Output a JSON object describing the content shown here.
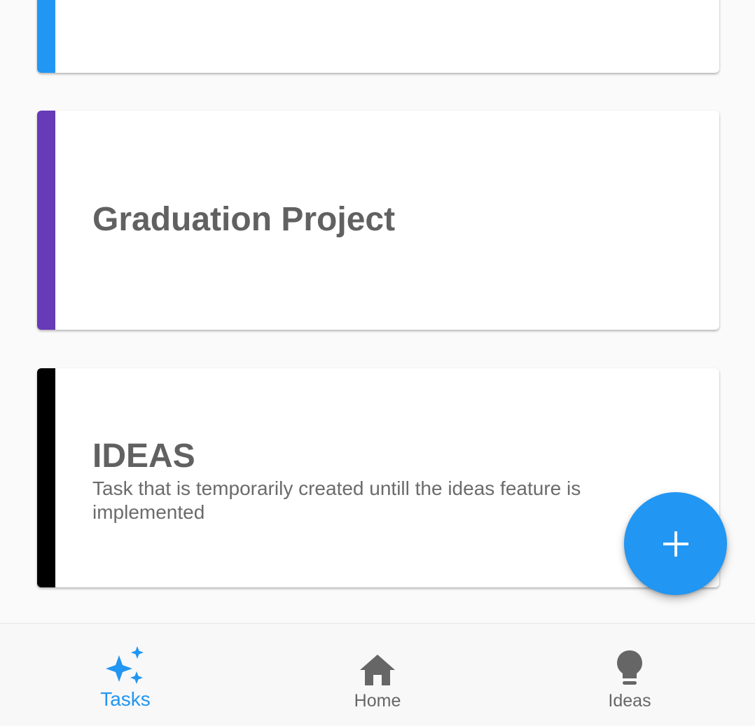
{
  "colors": {
    "accent": "#2196f3",
    "inactive": "#666666",
    "card_1_stripe": "#2196f3",
    "card_2_stripe": "#673ab7",
    "card_3_stripe": "#000000"
  },
  "cards": [
    {
      "title": "",
      "description": "",
      "stripe_color": "#2196f3"
    },
    {
      "title": "Graduation Project",
      "description": "",
      "stripe_color": "#673ab7"
    },
    {
      "title": "IDEAS",
      "description": "Task that is temporarily created untill the ideas feature is implemented",
      "stripe_color": "#000000"
    }
  ],
  "fab": {
    "icon": "plus-icon"
  },
  "bottom_nav": {
    "active": "Tasks",
    "items": [
      {
        "label": "Tasks",
        "icon": "sparkles-icon"
      },
      {
        "label": "Home",
        "icon": "home-icon"
      },
      {
        "label": "Ideas",
        "icon": "lightbulb-icon"
      }
    ]
  }
}
